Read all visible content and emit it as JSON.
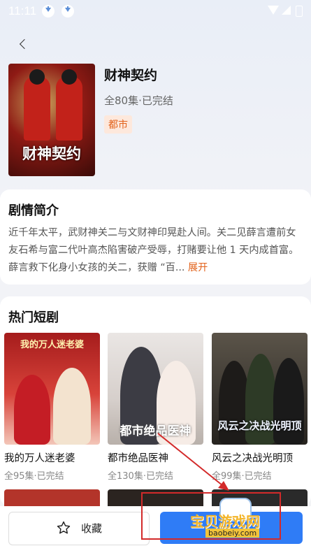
{
  "status_bar": {
    "time": "11:11"
  },
  "drama": {
    "cover_title": "财神契约",
    "title": "财神契约",
    "meta": "全80集·已完结",
    "genre": "都市"
  },
  "synopsis": {
    "heading": "剧情简介",
    "text": "近千年太平，武财神关二与文财神印晃赴人间。关二见薛言遭前女友石希与富二代叶高杰陷害破产受辱，打赌要让他 1 天内成首富。 薛言救下化身小女孩的关二，获赠 “百...",
    "expand_label": "展开"
  },
  "hot": {
    "heading": "热门短剧",
    "items": [
      {
        "name": "我的万人迷老婆",
        "meta": "全95集·已完结",
        "poster_text": "我的万人迷老婆"
      },
      {
        "name": "都市绝品医神",
        "meta": "全130集·已完结",
        "poster_text": "都市绝品医神"
      },
      {
        "name": "风云之决战光明顶",
        "meta": "全99集·已完结",
        "poster_text": "风云之决战光明顶"
      }
    ]
  },
  "bottom": {
    "collect_label": "收藏",
    "play_label": ""
  },
  "watermark": {
    "text": "宝贝游戏网",
    "url": "baobeiy.com"
  },
  "colors": {
    "accent": "#e2621b",
    "primary": "#2f7cf6",
    "annotation": "#d32a2a"
  }
}
